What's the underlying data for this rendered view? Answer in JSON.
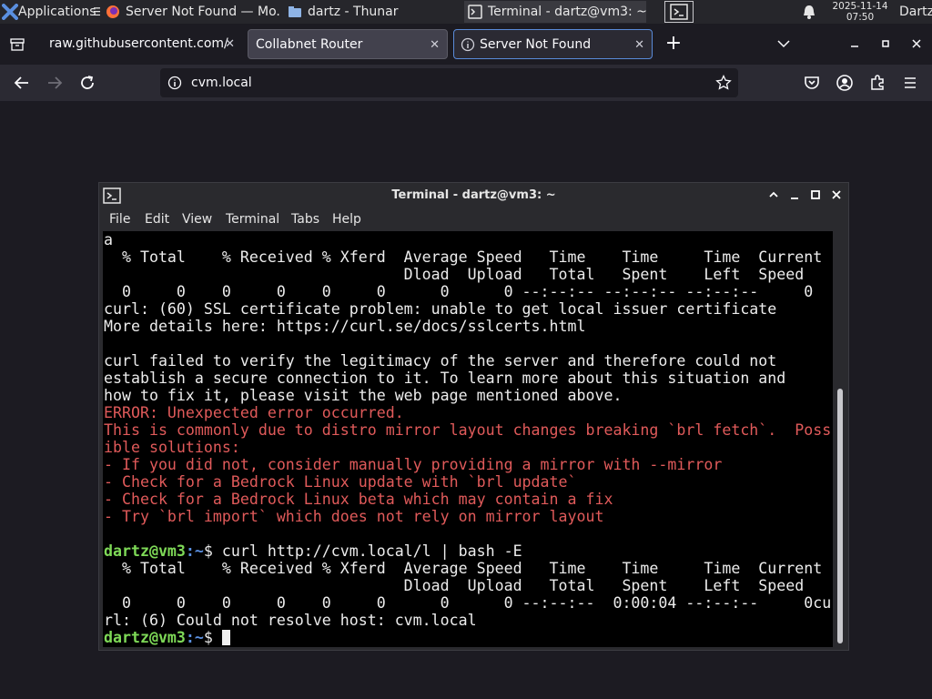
{
  "panel": {
    "applications_label": "Applications",
    "tasks": [
      {
        "label": "Server Not Found — Mo..."
      },
      {
        "label": "dartz - Thunar"
      },
      {
        "label": "Terminal - dartz@vm3: ~"
      }
    ],
    "clock": {
      "date": "2025-11-14",
      "time": "07:50"
    },
    "user": "Dartz"
  },
  "browser": {
    "tabs": [
      {
        "title": "raw.githubusercontent.com/"
      },
      {
        "title": "Collabnet Router"
      },
      {
        "title": "Server Not Found"
      }
    ],
    "url": "cvm.local"
  },
  "terminal": {
    "title": "Terminal - dartz@vm3: ~",
    "menu": [
      "File",
      "Edit",
      "View",
      "Terminal",
      "Tabs",
      "Help"
    ],
    "lines": [
      {
        "text": "a",
        "kind": "normal"
      },
      {
        "text": "  % Total    % Received % Xferd  Average Speed   Time    Time     Time  Current",
        "kind": "normal"
      },
      {
        "text": "                                 Dload  Upload   Total   Spent    Left  Speed",
        "kind": "normal"
      },
      {
        "text": "  0     0    0     0    0     0      0      0 --:--:-- --:--:-- --:--:--     0",
        "kind": "normal"
      },
      {
        "text": "curl: (60) SSL certificate problem: unable to get local issuer certificate",
        "kind": "normal"
      },
      {
        "text": "More details here: https://curl.se/docs/sslcerts.html",
        "kind": "normal"
      },
      {
        "text": "",
        "kind": "normal"
      },
      {
        "text": "curl failed to verify the legitimacy of the server and therefore could not",
        "kind": "normal"
      },
      {
        "text": "establish a secure connection to it. To learn more about this situation and",
        "kind": "normal"
      },
      {
        "text": "how to fix it, please visit the web page mentioned above.",
        "kind": "normal"
      },
      {
        "text": "ERROR: Unexpected error occurred.",
        "kind": "err"
      },
      {
        "text": "This is commonly due to distro mirror layout changes breaking `brl fetch`.  Poss",
        "kind": "err"
      },
      {
        "text": "ible solutions:",
        "kind": "err"
      },
      {
        "text": "- If you did not, consider manually providing a mirror with --mirror",
        "kind": "err"
      },
      {
        "text": "- Check for a Bedrock Linux update with `brl update`",
        "kind": "err"
      },
      {
        "text": "- Check for a Bedrock Linux beta which may contain a fix",
        "kind": "err"
      },
      {
        "text": "- Try `brl import` which does not rely on mirror layout",
        "kind": "err"
      },
      {
        "text": "",
        "kind": "normal"
      },
      {
        "kind": "prompt",
        "user": "dartz@vm3",
        "path": ":~",
        "sym": "$ ",
        "cmd": "curl http://cvm.local/l | bash -E"
      },
      {
        "text": "  % Total    % Received % Xferd  Average Speed   Time    Time     Time  Current",
        "kind": "normal"
      },
      {
        "text": "                                 Dload  Upload   Total   Spent    Left  Speed",
        "kind": "normal"
      },
      {
        "text": "  0     0    0     0    0     0      0      0 --:--:--  0:00:04 --:--:--     0cu",
        "kind": "normal"
      },
      {
        "text": "rl: (6) Could not resolve host: cvm.local",
        "kind": "normal"
      },
      {
        "kind": "prompt",
        "user": "dartz@vm3",
        "path": ":~",
        "sym": "$ ",
        "cmd": "",
        "cursor": true
      }
    ]
  },
  "colors": {
    "panel_bg": "#26262b",
    "firefox_bg": "#1c1b22",
    "terminal_bg": "#000000",
    "error_text": "#e05a5a",
    "prompt_user": "#7ed957",
    "prompt_path": "#5a8fe0"
  }
}
